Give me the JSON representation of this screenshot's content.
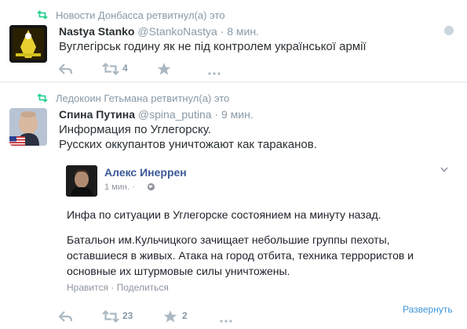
{
  "tweet1": {
    "retweeted_by": "Новости Донбасса ретвитнул(а) это",
    "name": "Nastya Stanko",
    "handle": "@StankoNastya",
    "separator": "·",
    "time": "8 мин.",
    "text": "Вуглегірськ годину як не під контролем української армії",
    "retweet_count": "4"
  },
  "tweet2": {
    "retweeted_by": "Ледокоин Гетьмана ретвитнул(а) это",
    "name": "Спина Путина",
    "handle": "@spina_putina",
    "separator": "·",
    "time": "9 мин.",
    "text_lines": [
      "Информация по Углегорску.",
      "Русских оккупантов уничтожают как тараканов."
    ],
    "quoted": {
      "author": "Алекс Инеррен",
      "time": "1 мин.",
      "separator": "·",
      "paragraph1": "Инфа по ситуации в Углегорске состоянием на минуту назад.",
      "paragraph2_lines": [
        "Батальон им.Кульчицкого зачищает небольшие группы пехоты,",
        "оставшиеся в живых. Атака на город отбита, техника террористов и",
        "основные их штурмовые силы уничтожены."
      ],
      "like_label": "Нравится",
      "share_label": "Поделиться",
      "link_sep": "·"
    },
    "retweet_count": "23",
    "favorite_count": "2",
    "expand_label": "Развернуть"
  },
  "colors": {
    "accent": "#3b94d9",
    "retweet_icon": "#19cf86",
    "muted": "#8899a6",
    "icon_grey": "#aab8c2",
    "facebook_name": "#3b5998"
  },
  "icons": [
    "retweet-icon",
    "reply-icon",
    "favorite-icon",
    "globe-icon",
    "chevron-down-icon",
    "flag-icon"
  ]
}
